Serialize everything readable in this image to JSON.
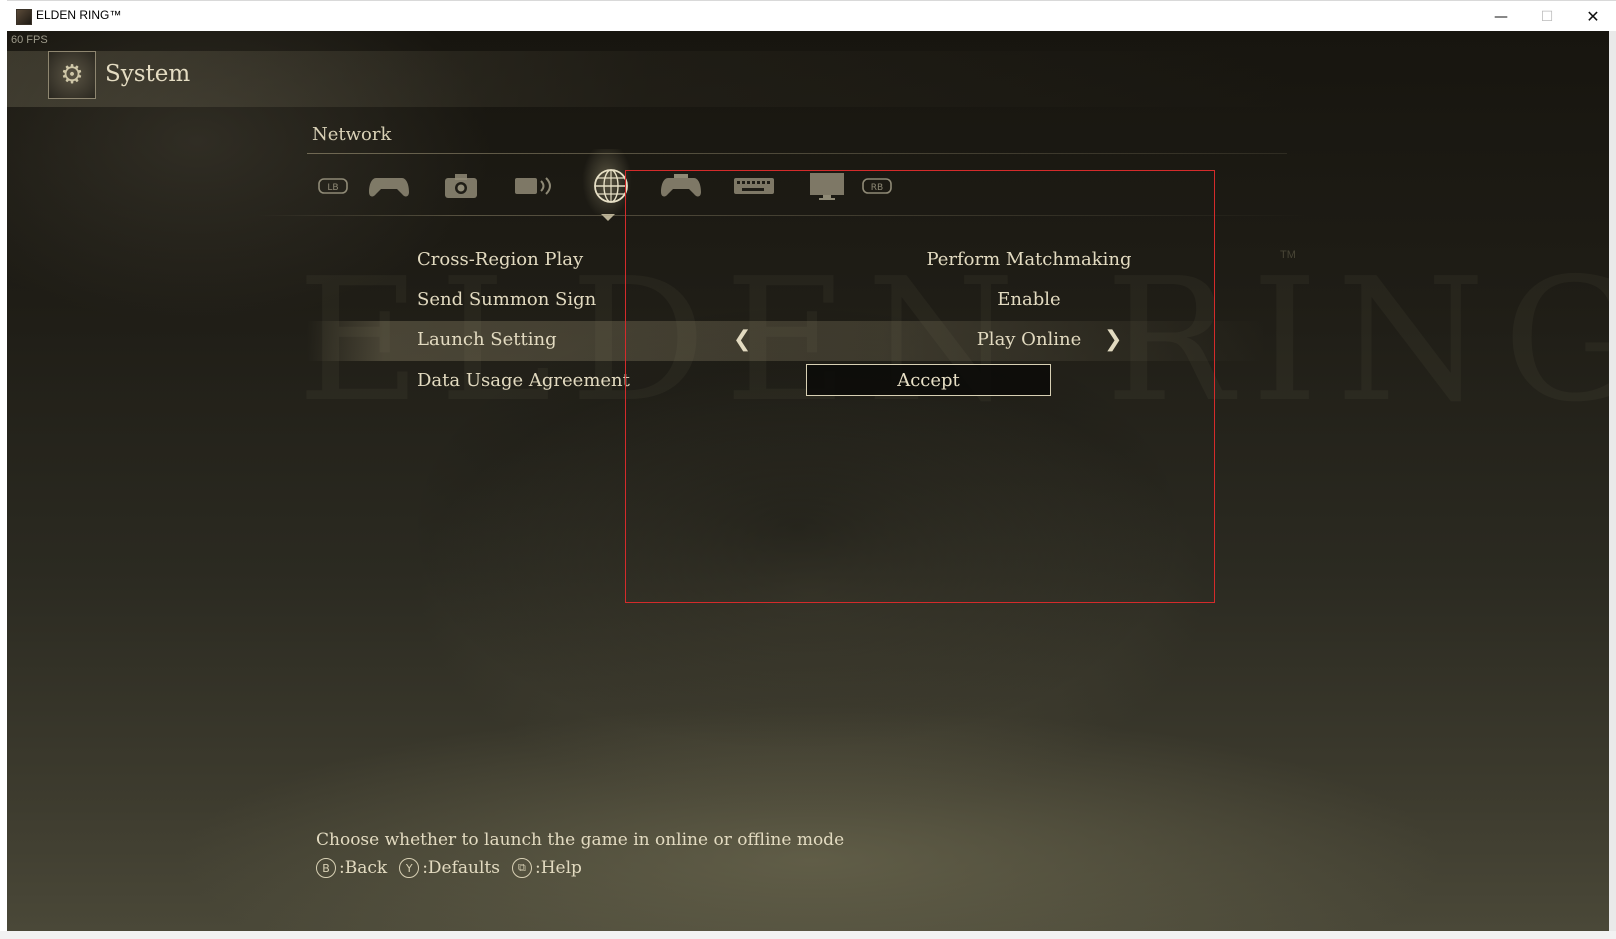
{
  "window": {
    "title": "ELDEN RING™",
    "minimize_icon": "minimize-icon",
    "maximize_icon": "maximize-icon",
    "close_icon": "close-icon"
  },
  "overlay": {
    "fps": "60 FPS"
  },
  "header": {
    "title": "System",
    "icon": "gears-icon"
  },
  "section": {
    "title": "Network",
    "tabs": [
      {
        "name": "lb-bumper",
        "label": "LB",
        "active": false
      },
      {
        "name": "game-controller",
        "active": false
      },
      {
        "name": "camera",
        "active": false
      },
      {
        "name": "sound",
        "active": false
      },
      {
        "name": "network-globe",
        "active": true
      },
      {
        "name": "controls",
        "active": false
      },
      {
        "name": "keyboard",
        "active": false
      },
      {
        "name": "display-monitor",
        "active": false
      },
      {
        "name": "rb-bumper",
        "label": "RB",
        "active": false
      }
    ]
  },
  "settings": [
    {
      "label": "Cross-Region Play",
      "value": "Perform Matchmaking"
    },
    {
      "label": "Send Summon Sign",
      "value": "Enable"
    },
    {
      "label": "Launch Setting",
      "value": "Play Online",
      "selected": true
    },
    {
      "label": "Data Usage Agreement",
      "value": "Accept"
    }
  ],
  "footer": {
    "help": "Choose whether to launch the game in online or offline mode",
    "hints": [
      {
        "glyph": "B",
        "label": ":Back"
      },
      {
        "glyph": "Y",
        "label": ":Defaults"
      },
      {
        "glyph": "⧉",
        "label": ":Help"
      }
    ]
  },
  "colors": {
    "text": "#e2dac0",
    "highlight_box": "#d42b2b"
  }
}
